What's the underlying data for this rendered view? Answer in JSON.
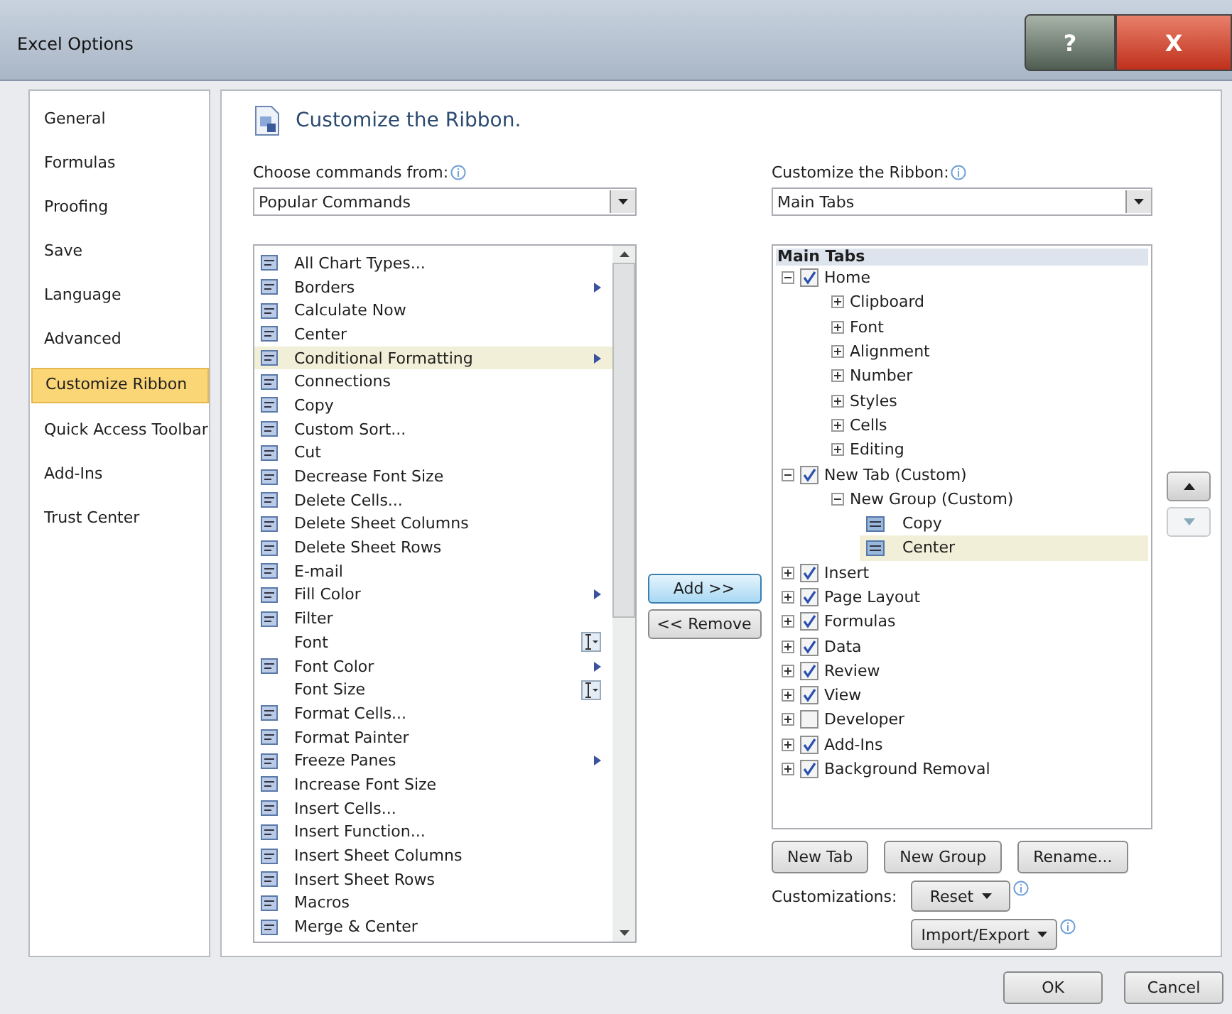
{
  "window": {
    "title": "Excel Options",
    "help": "?",
    "close": "X"
  },
  "nav": [
    {
      "label": "General",
      "selected": false
    },
    {
      "label": "Formulas",
      "selected": false
    },
    {
      "label": "Proofing",
      "selected": false
    },
    {
      "label": "Save",
      "selected": false
    },
    {
      "label": "Language",
      "selected": false
    },
    {
      "label": "Advanced",
      "selected": false
    },
    {
      "label": "Customize Ribbon",
      "selected": true
    },
    {
      "label": "Quick Access Toolbar",
      "selected": false
    },
    {
      "label": "Add-Ins",
      "selected": false
    },
    {
      "label": "Trust Center",
      "selected": false
    }
  ],
  "heading": "Customize the Ribbon.",
  "commands_from": {
    "label": "Choose commands from:",
    "value": "Popular Commands"
  },
  "commands": [
    {
      "label": "All Chart Types...",
      "kind": "plain",
      "icon": true,
      "selected": false
    },
    {
      "label": "Borders",
      "kind": "submenu",
      "icon": true,
      "selected": false
    },
    {
      "label": "Calculate Now",
      "kind": "plain",
      "icon": true,
      "selected": false
    },
    {
      "label": "Center",
      "kind": "plain",
      "icon": true,
      "selected": false
    },
    {
      "label": "Conditional Formatting",
      "kind": "submenu",
      "icon": true,
      "selected": true
    },
    {
      "label": "Connections",
      "kind": "plain",
      "icon": true,
      "selected": false
    },
    {
      "label": "Copy",
      "kind": "plain",
      "icon": true,
      "selected": false
    },
    {
      "label": "Custom Sort...",
      "kind": "plain",
      "icon": true,
      "selected": false
    },
    {
      "label": "Cut",
      "kind": "plain",
      "icon": true,
      "selected": false
    },
    {
      "label": "Decrease Font Size",
      "kind": "plain",
      "icon": true,
      "selected": false
    },
    {
      "label": "Delete Cells...",
      "kind": "plain",
      "icon": true,
      "selected": false
    },
    {
      "label": "Delete Sheet Columns",
      "kind": "plain",
      "icon": true,
      "selected": false
    },
    {
      "label": "Delete Sheet Rows",
      "kind": "plain",
      "icon": true,
      "selected": false
    },
    {
      "label": "E-mail",
      "kind": "plain",
      "icon": true,
      "selected": false
    },
    {
      "label": "Fill Color",
      "kind": "submenu",
      "icon": true,
      "selected": false
    },
    {
      "label": "Filter",
      "kind": "plain",
      "icon": true,
      "selected": false
    },
    {
      "label": "Font",
      "kind": "combo",
      "icon": false,
      "selected": false
    },
    {
      "label": "Font Color",
      "kind": "submenu",
      "icon": true,
      "selected": false
    },
    {
      "label": "Font Size",
      "kind": "combo",
      "icon": false,
      "selected": false
    },
    {
      "label": "Format Cells...",
      "kind": "plain",
      "icon": true,
      "selected": false
    },
    {
      "label": "Format Painter",
      "kind": "plain",
      "icon": true,
      "selected": false
    },
    {
      "label": "Freeze Panes",
      "kind": "submenu",
      "icon": true,
      "selected": false
    },
    {
      "label": "Increase Font Size",
      "kind": "plain",
      "icon": true,
      "selected": false
    },
    {
      "label": "Insert Cells...",
      "kind": "plain",
      "icon": true,
      "selected": false
    },
    {
      "label": "Insert Function...",
      "kind": "plain",
      "icon": true,
      "selected": false
    },
    {
      "label": "Insert Sheet Columns",
      "kind": "plain",
      "icon": true,
      "selected": false
    },
    {
      "label": "Insert Sheet Rows",
      "kind": "plain",
      "icon": true,
      "selected": false
    },
    {
      "label": "Macros",
      "kind": "plain",
      "icon": true,
      "selected": false
    },
    {
      "label": "Merge & Center",
      "kind": "plain",
      "icon": true,
      "selected": false
    }
  ],
  "add_button": "Add >>",
  "remove_button": "<< Remove",
  "customize_ribbon": {
    "label": "Customize the Ribbon:",
    "value": "Main Tabs"
  },
  "tree": {
    "header": "Main Tabs",
    "items": [
      {
        "label": "Home",
        "kind": "tab",
        "checked": true,
        "expanded": true,
        "selected": false,
        "children": [
          {
            "label": "Clipboard",
            "kind": "group",
            "expanded": false,
            "selected": false
          },
          {
            "label": "Font",
            "kind": "group",
            "expanded": false,
            "selected": false
          },
          {
            "label": "Alignment",
            "kind": "group",
            "expanded": false,
            "selected": false
          },
          {
            "label": "Number",
            "kind": "group",
            "expanded": false,
            "selected": false
          },
          {
            "label": "Styles",
            "kind": "group",
            "expanded": false,
            "selected": false
          },
          {
            "label": "Cells",
            "kind": "group",
            "expanded": false,
            "selected": false
          },
          {
            "label": "Editing",
            "kind": "group",
            "expanded": false,
            "selected": false
          }
        ]
      },
      {
        "label": "New Tab (Custom)",
        "kind": "tab",
        "checked": true,
        "expanded": true,
        "selected": false,
        "children": [
          {
            "label": "New Group (Custom)",
            "kind": "group",
            "expanded": true,
            "selected": false,
            "children": [
              {
                "label": "Copy",
                "kind": "command",
                "selected": false
              },
              {
                "label": "Center",
                "kind": "command",
                "selected": true
              }
            ]
          }
        ]
      },
      {
        "label": "Insert",
        "kind": "tab",
        "checked": true,
        "expanded": false,
        "selected": false
      },
      {
        "label": "Page Layout",
        "kind": "tab",
        "checked": true,
        "expanded": false,
        "selected": false
      },
      {
        "label": "Formulas",
        "kind": "tab",
        "checked": true,
        "expanded": false,
        "selected": false
      },
      {
        "label": "Data",
        "kind": "tab",
        "checked": true,
        "expanded": false,
        "selected": false
      },
      {
        "label": "Review",
        "kind": "tab",
        "checked": true,
        "expanded": false,
        "selected": false
      },
      {
        "label": "View",
        "kind": "tab",
        "checked": true,
        "expanded": false,
        "selected": false
      },
      {
        "label": "Developer",
        "kind": "tab",
        "checked": false,
        "expanded": false,
        "selected": false
      },
      {
        "label": "Add-Ins",
        "kind": "tab",
        "checked": true,
        "expanded": false,
        "selected": false
      },
      {
        "label": "Background Removal",
        "kind": "tab",
        "checked": true,
        "expanded": false,
        "selected": false
      }
    ]
  },
  "tree_buttons": [
    "New Tab",
    "New Group",
    "Rename..."
  ],
  "customizations": {
    "label": "Customizations:",
    "reset": "Reset",
    "import_export": "Import/Export"
  },
  "footer_buttons": [
    "OK",
    "Cancel"
  ]
}
